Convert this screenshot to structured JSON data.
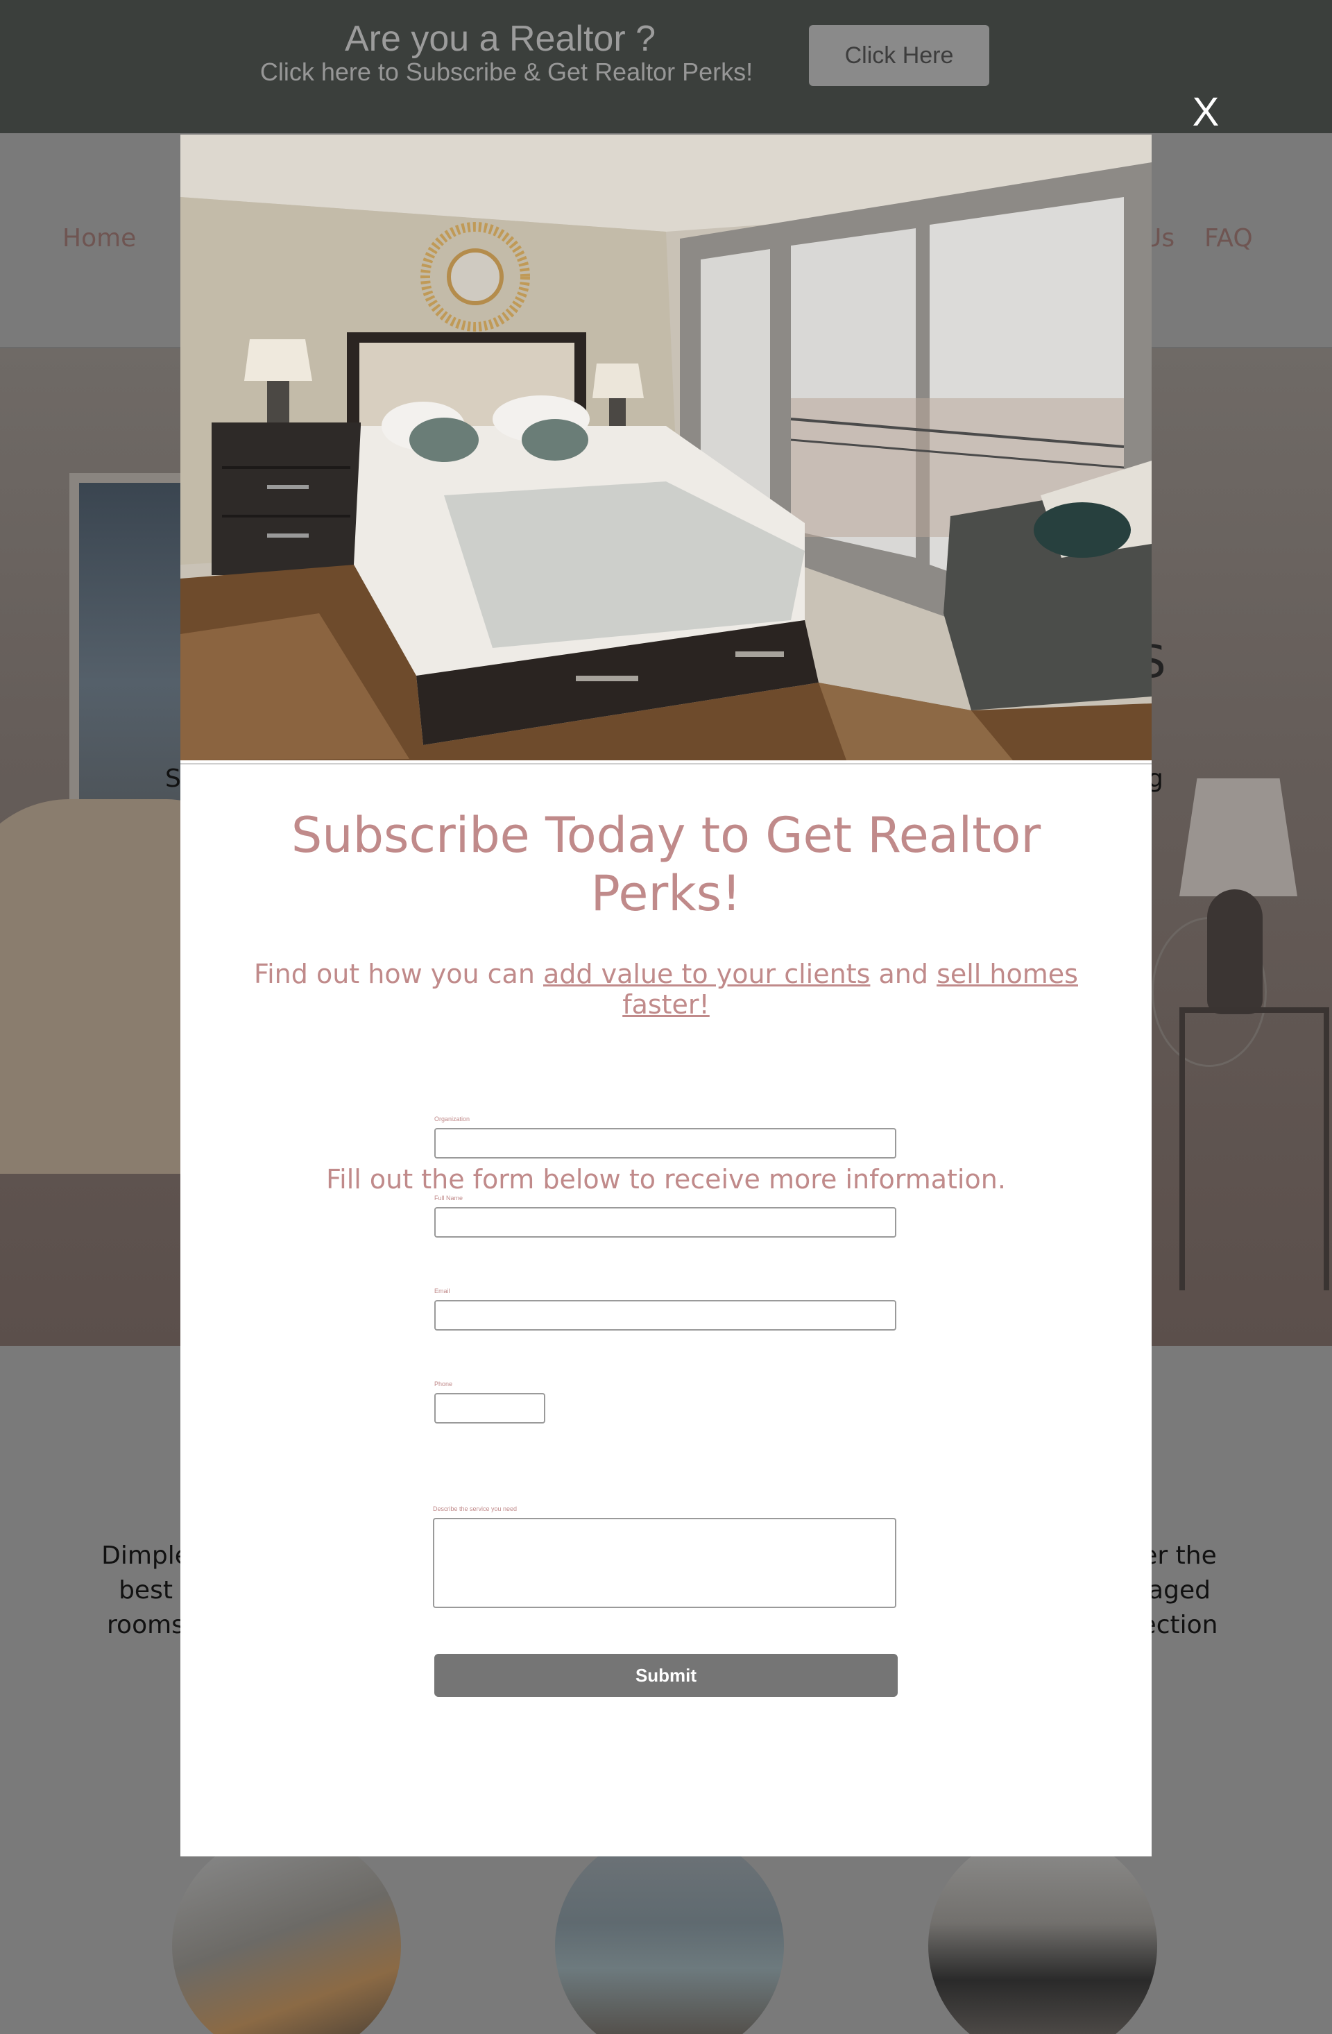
{
  "banner": {
    "title": "Are you a Realtor ?",
    "subtitle": "Click here to Subscribe & Get Realtor Perks!",
    "button_label": "Click Here"
  },
  "nav": {
    "home": "Home",
    "us_fragment": "Us",
    "faq": "FAQ"
  },
  "hero": {
    "fragment_s": "S",
    "fragment_left": "S",
    "fragment_right": "g"
  },
  "about": {
    "left_lines": [
      "Dimple",
      "best",
      "rooms"
    ],
    "right_lines": [
      "er the",
      "aged",
      "ection"
    ]
  },
  "modal": {
    "close_label": "X",
    "title": "Subscribe Today to Get Realtor Perks!",
    "intro_prefix": "Find out how you can ",
    "intro_link1": "add value to your clients",
    "intro_mid": " and ",
    "intro_link2": "sell homes faster!",
    "instruction": "Fill out the form below to receive more information.",
    "fields": {
      "organization_label": "Organization",
      "full_name_label": "Full Name",
      "email_label": "Email",
      "phone_label": "Phone",
      "service_label": "Describe the service you need"
    },
    "submit_label": "Submit"
  }
}
